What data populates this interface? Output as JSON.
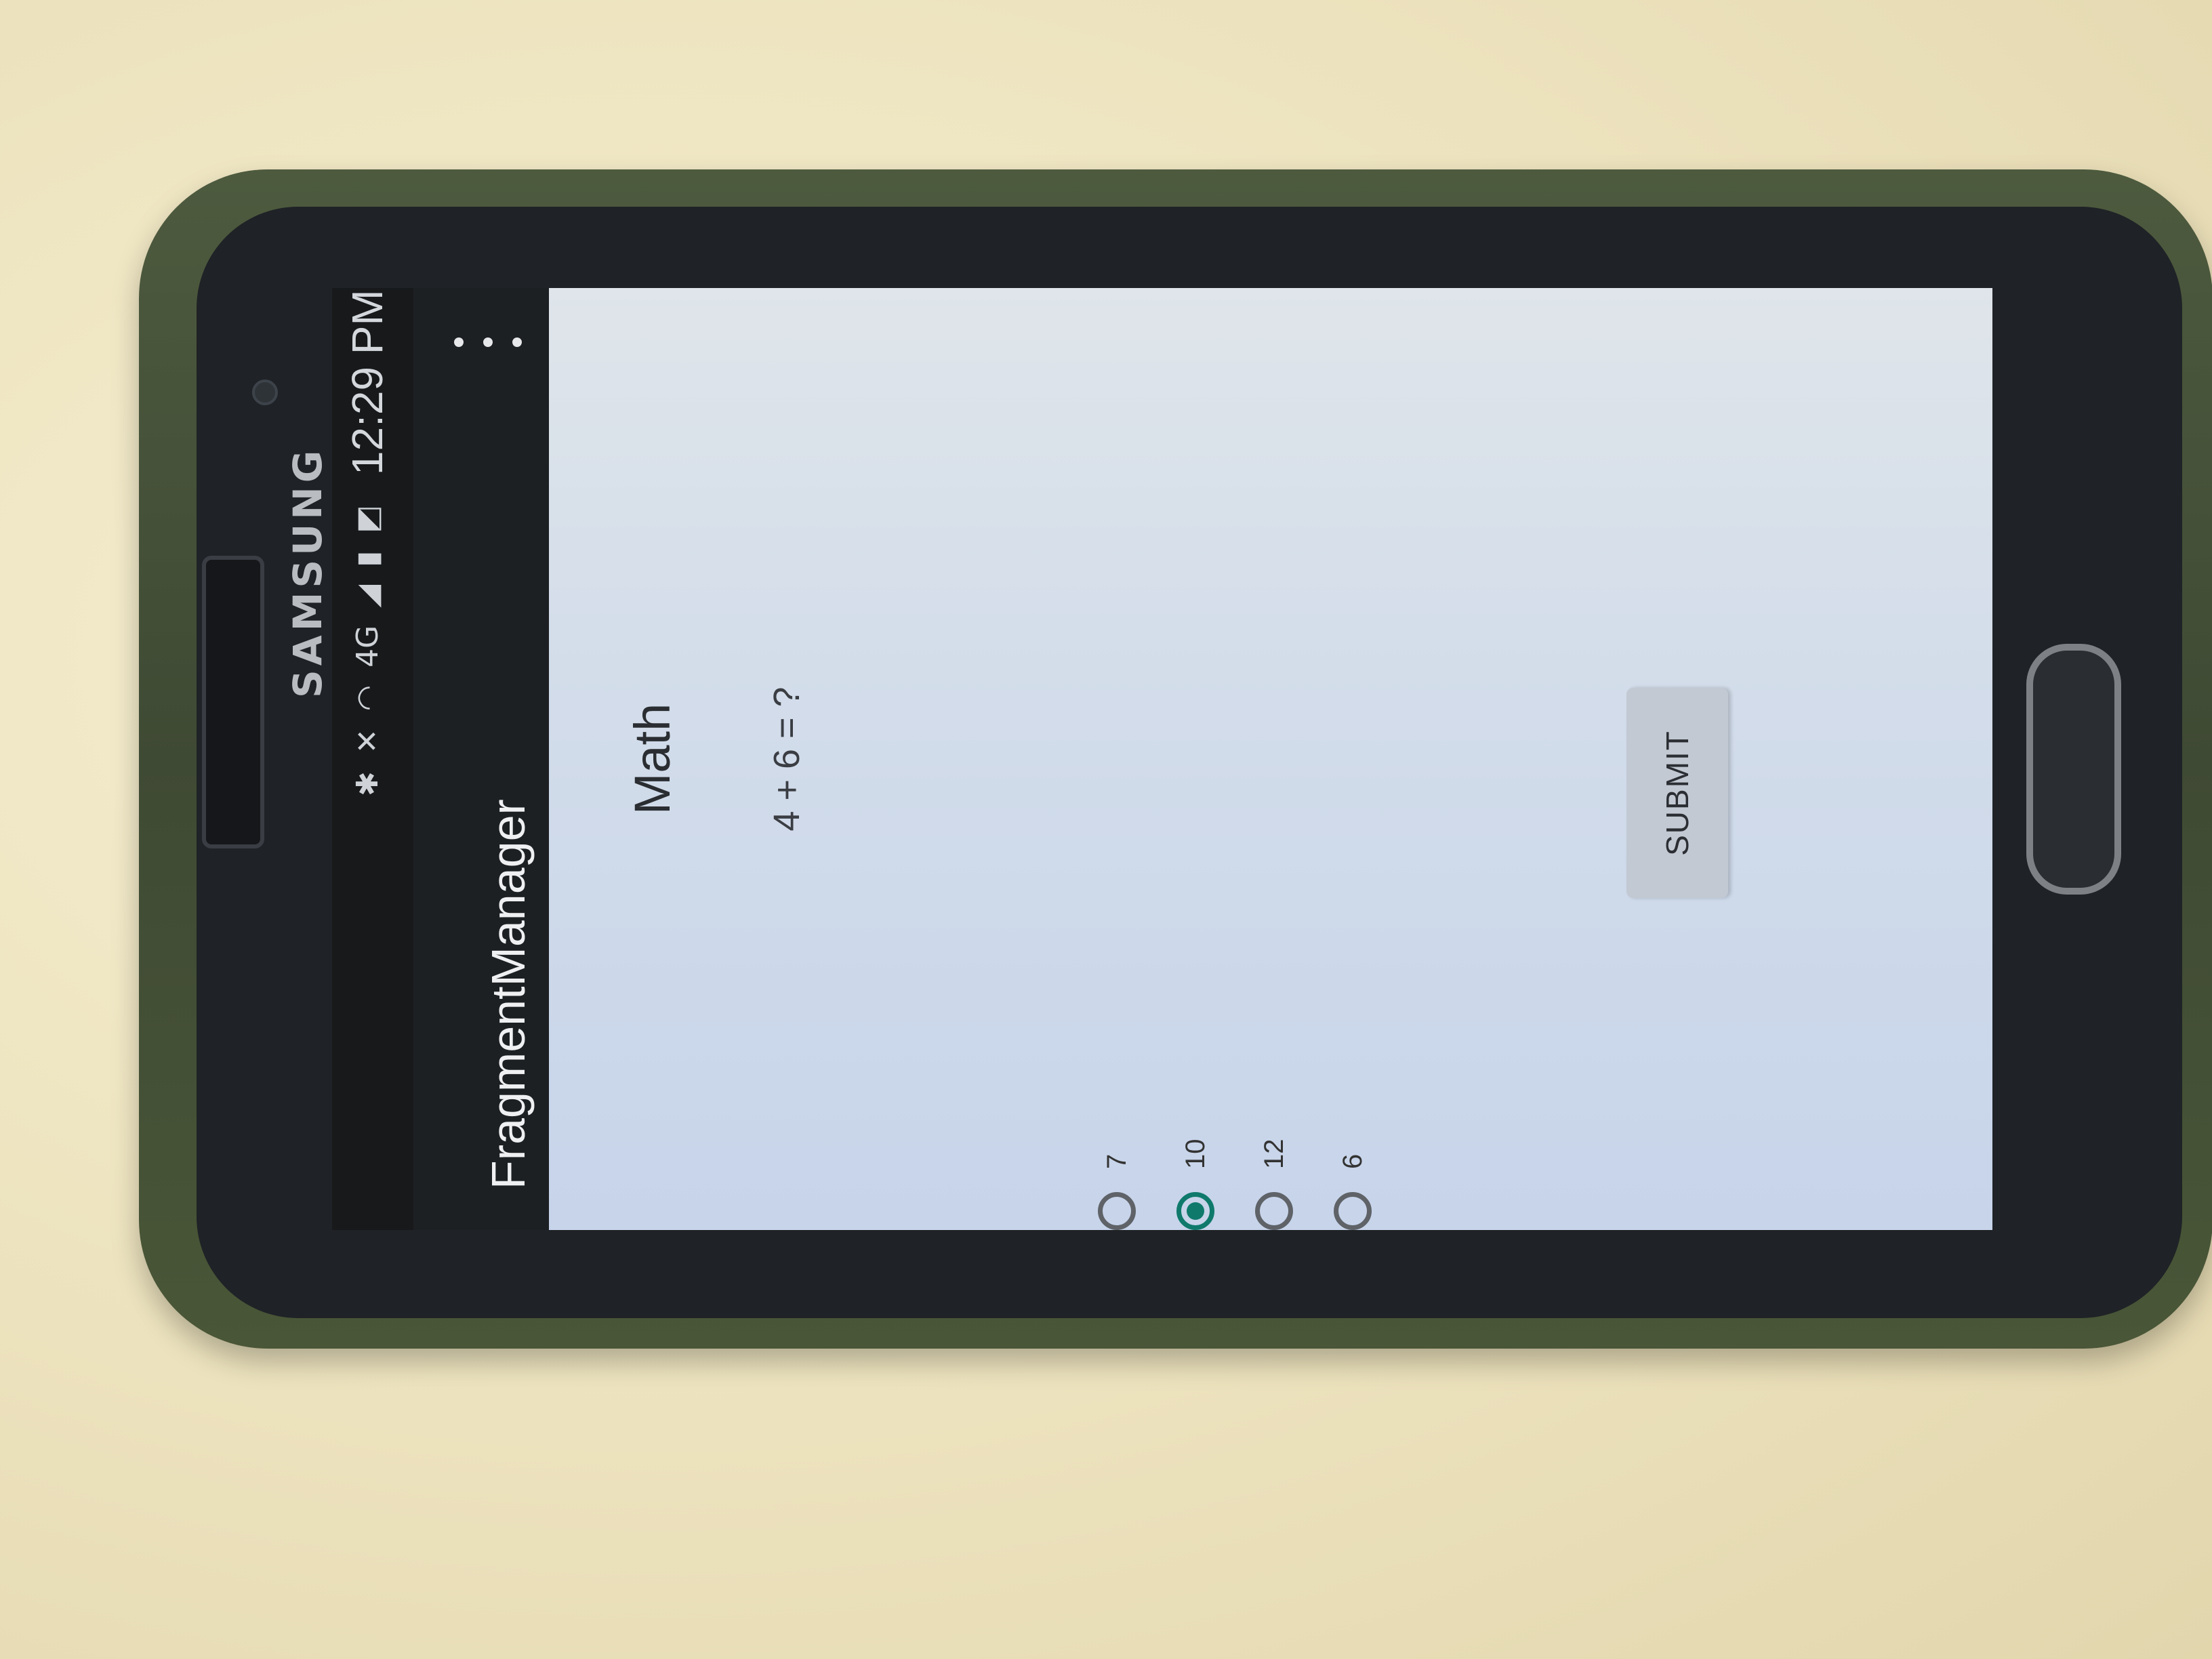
{
  "device": {
    "brand": "SAMSUNG"
  },
  "status_bar": {
    "icons": [
      "bluetooth-icon",
      "mute-icon",
      "wifi-icon",
      "lte-icon",
      "signal-icon",
      "battery-icon",
      "notification-icon"
    ],
    "network": "4G",
    "time": "12:29 PM"
  },
  "app_bar": {
    "title": "FragmentManager",
    "menu_icon": "overflow-menu-icon"
  },
  "quiz": {
    "title": "Math",
    "question": "4 + 6 = ?",
    "options": [
      {
        "label": "7",
        "checked": false
      },
      {
        "label": "10",
        "checked": true
      },
      {
        "label": "12",
        "checked": false
      },
      {
        "label": "6",
        "checked": false
      }
    ],
    "submit_label": "SUBMIT"
  },
  "colors": {
    "accent": "#0f7a6c",
    "toolbar": "#1d2023",
    "background": "#cdd8e9"
  }
}
